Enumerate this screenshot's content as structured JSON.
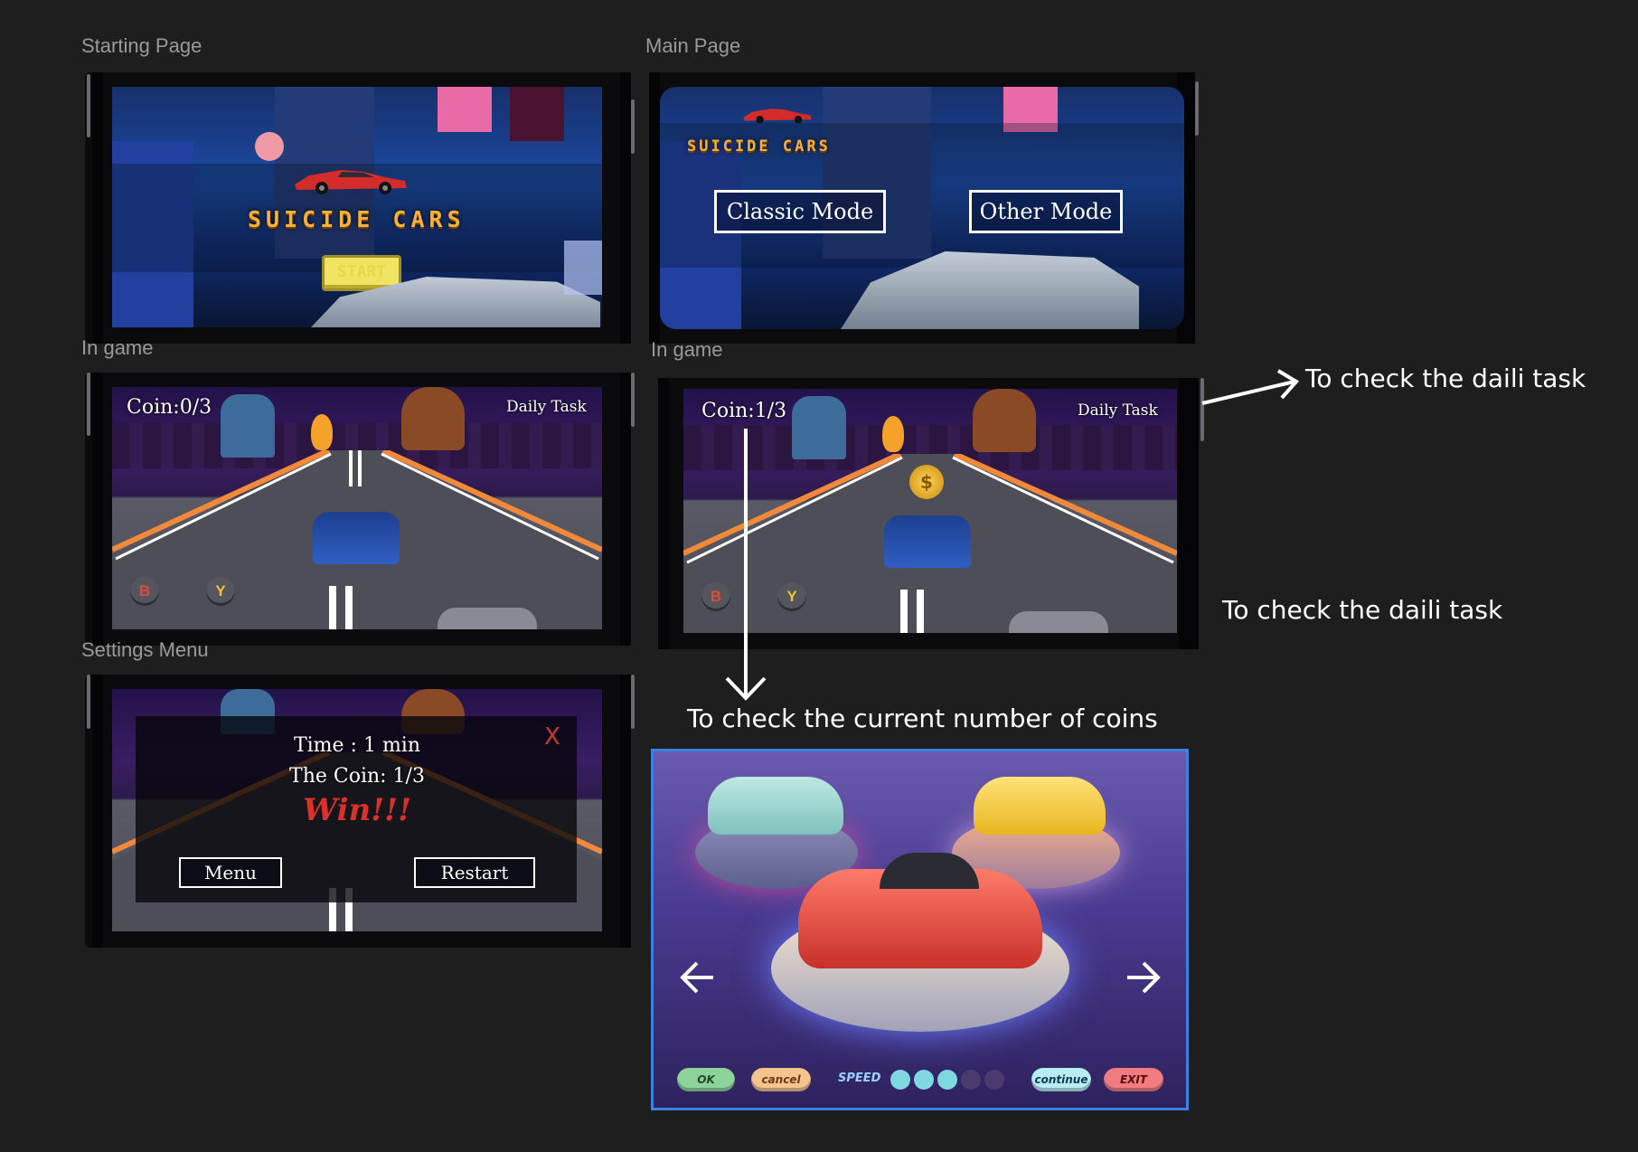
{
  "frames": {
    "starting_page": "Starting Page",
    "main_page": "Main Page",
    "in_game_1": "In game",
    "in_game_2": "In game",
    "settings_menu": "Settings Menu"
  },
  "starting": {
    "title": "SUICIDE CARS",
    "start_label": "START"
  },
  "main": {
    "title": "SUICIDE CARS",
    "classic_mode": "Classic Mode",
    "other_mode": "Other Mode"
  },
  "game1": {
    "coin": "Coin:0/3",
    "daily_task": "Daily Task",
    "btn_b": "B",
    "btn_y": "Y"
  },
  "game2": {
    "coin": "Coin:1/3",
    "daily_task": "Daily Task",
    "btn_b": "B",
    "btn_y": "Y",
    "coin_symbol": "$"
  },
  "settings": {
    "time": "Time : 1 min",
    "coin": "The Coin: 1/3",
    "result": "Win!!!",
    "menu": "Menu",
    "restart": "Restart",
    "close": "X"
  },
  "annotations": {
    "daily_task_arrow": "To check the daili task",
    "daily_task_plain": "To check the daili task",
    "coins": "To check the current number of coins"
  },
  "car_select": {
    "ok": "OK",
    "cancel": "cancel",
    "speed": "SPEED",
    "continue": "continue",
    "exit": "EXIT",
    "speed_level": 3,
    "speed_max": 5
  },
  "colors": {
    "background": "#1e1e1e",
    "title_gold": "#f3b33a",
    "win_red": "#d8322a",
    "select_border": "#3b82e0"
  }
}
